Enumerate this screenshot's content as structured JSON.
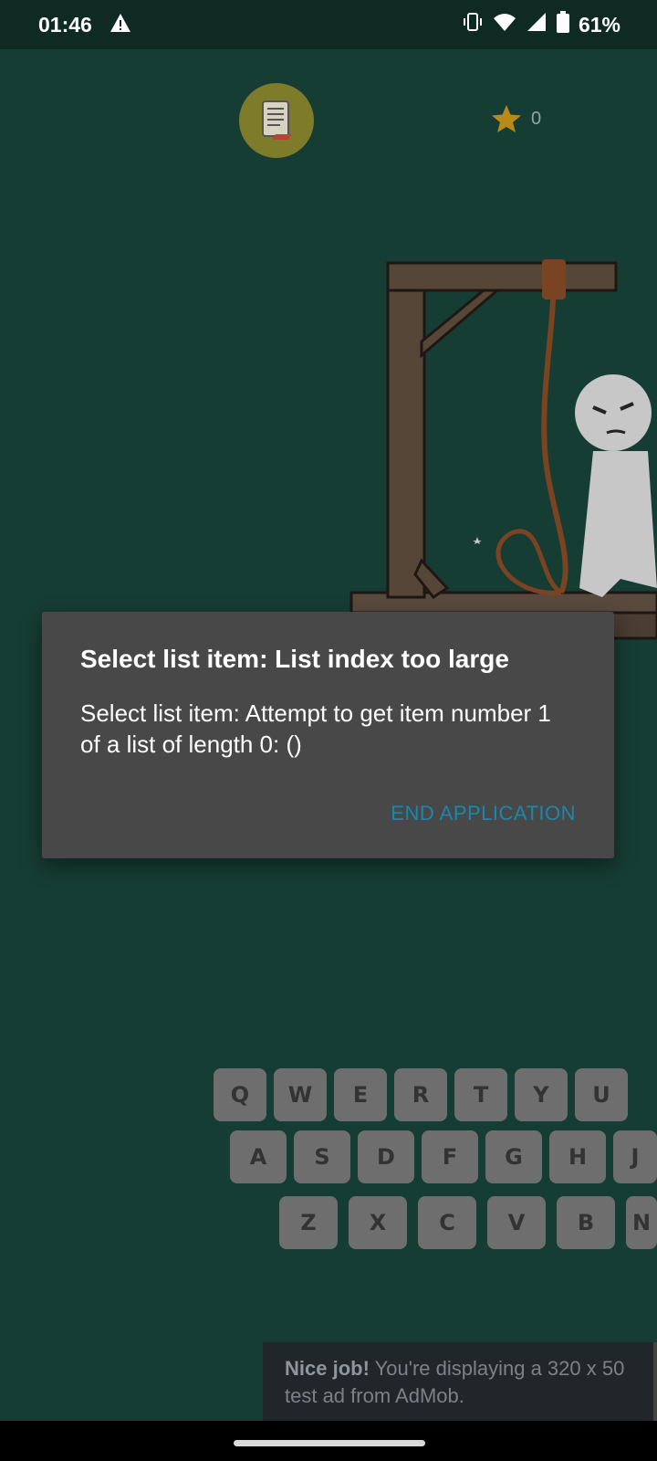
{
  "status_bar": {
    "time": "01:46",
    "battery": "61%"
  },
  "game": {
    "score": "0"
  },
  "dialog": {
    "title": "Select list item: List index too large",
    "message": "Select list item: Attempt to get item number 1 of a list of length 0: ()",
    "button": "END APPLICATION"
  },
  "keyboard": {
    "row1": [
      "Q",
      "W",
      "E",
      "R",
      "T",
      "Y",
      "U"
    ],
    "row2": [
      "A",
      "S",
      "D",
      "F",
      "G",
      "H",
      "J"
    ],
    "row3": [
      "Z",
      "X",
      "C",
      "V",
      "B",
      "N"
    ]
  },
  "ad": {
    "lead": "Nice job!",
    "text": " You're displaying a 320 x 50 test ad from AdMob."
  },
  "colors": {
    "background": "#163d33",
    "dialog": "#484848",
    "accent": "#1a87ad",
    "key": "#6e6e6e"
  }
}
